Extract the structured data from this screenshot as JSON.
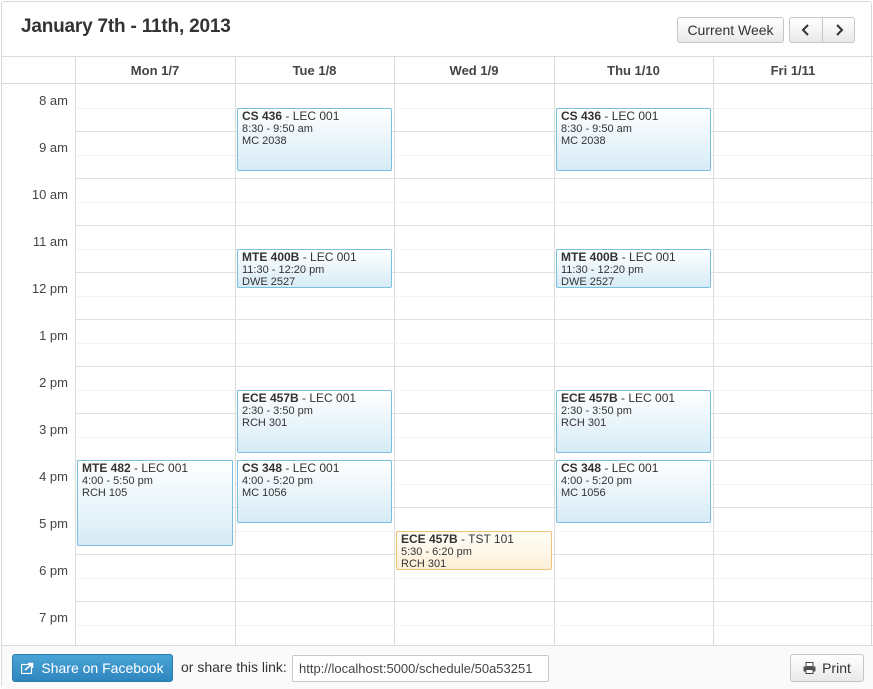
{
  "header": {
    "title": "January 7th - 11th, 2013",
    "current_week_label": "Current Week",
    "prev_icon": "chevron-left-icon",
    "next_icon": "chevron-right-icon"
  },
  "days": [
    "Mon 1/7",
    "Tue 1/8",
    "Wed 1/9",
    "Thu 1/10",
    "Fri 1/11"
  ],
  "times": [
    "8 am",
    "9 am",
    "10 am",
    "11 am",
    "12 pm",
    "1 pm",
    "2 pm",
    "3 pm",
    "4 pm",
    "5 pm",
    "6 pm",
    "7 pm"
  ],
  "events": [
    {
      "day": 1,
      "start": 8.5,
      "end": 9.833,
      "code": "CS 436",
      "section": " - LEC 001",
      "time": "8:30 - 9:50 am",
      "room": "MC 2038",
      "kind": "class"
    },
    {
      "day": 3,
      "start": 8.5,
      "end": 9.833,
      "code": "CS 436",
      "section": " - LEC 001",
      "time": "8:30 - 9:50 am",
      "room": "MC 2038",
      "kind": "class"
    },
    {
      "day": 1,
      "start": 11.5,
      "end": 12.333,
      "code": "MTE 400B",
      "section": " - LEC 001",
      "time": "11:30 - 12:20 pm",
      "room": "DWE 2527",
      "kind": "class"
    },
    {
      "day": 3,
      "start": 11.5,
      "end": 12.333,
      "code": "MTE 400B",
      "section": " - LEC 001",
      "time": "11:30 - 12:20 pm",
      "room": "DWE 2527",
      "kind": "class"
    },
    {
      "day": 1,
      "start": 14.5,
      "end": 15.833,
      "code": "ECE 457B",
      "section": " - LEC 001",
      "time": "2:30 - 3:50 pm",
      "room": "RCH 301",
      "kind": "class"
    },
    {
      "day": 3,
      "start": 14.5,
      "end": 15.833,
      "code": "ECE 457B",
      "section": " - LEC 001",
      "time": "2:30 - 3:50 pm",
      "room": "RCH 301",
      "kind": "class"
    },
    {
      "day": 1,
      "start": 16,
      "end": 17.333,
      "code": "CS 348",
      "section": " - LEC 001",
      "time": "4:00 - 5:20 pm",
      "room": "MC 1056",
      "kind": "class"
    },
    {
      "day": 3,
      "start": 16,
      "end": 17.333,
      "code": "CS 348",
      "section": " - LEC 001",
      "time": "4:00 - 5:20 pm",
      "room": "MC 1056",
      "kind": "class"
    },
    {
      "day": 0,
      "start": 16,
      "end": 17.833,
      "code": "MTE 482",
      "section": " - LEC 001",
      "time": "4:00 - 5:50 pm",
      "room": "RCH 105",
      "kind": "class"
    },
    {
      "day": 2,
      "start": 17.5,
      "end": 18.333,
      "code": "ECE 457B",
      "section": " - TST 101",
      "time": "5:30 - 6:20 pm",
      "room": "RCH 301",
      "kind": "exam"
    }
  ],
  "footer": {
    "facebook_label": "Share on Facebook",
    "share_text": "or share this link:",
    "share_link": "http://localhost:5000/schedule/50a53251",
    "print_label": "Print",
    "facebook_icon": "share-icon",
    "print_icon": "printer-icon"
  },
  "colors": {
    "event_border": "#7bbfdf",
    "event_fill": "#d6ebf6",
    "exam_border": "#f0c27a",
    "exam_fill": "#fdf0d7",
    "facebook_button": "#3a93cc"
  }
}
